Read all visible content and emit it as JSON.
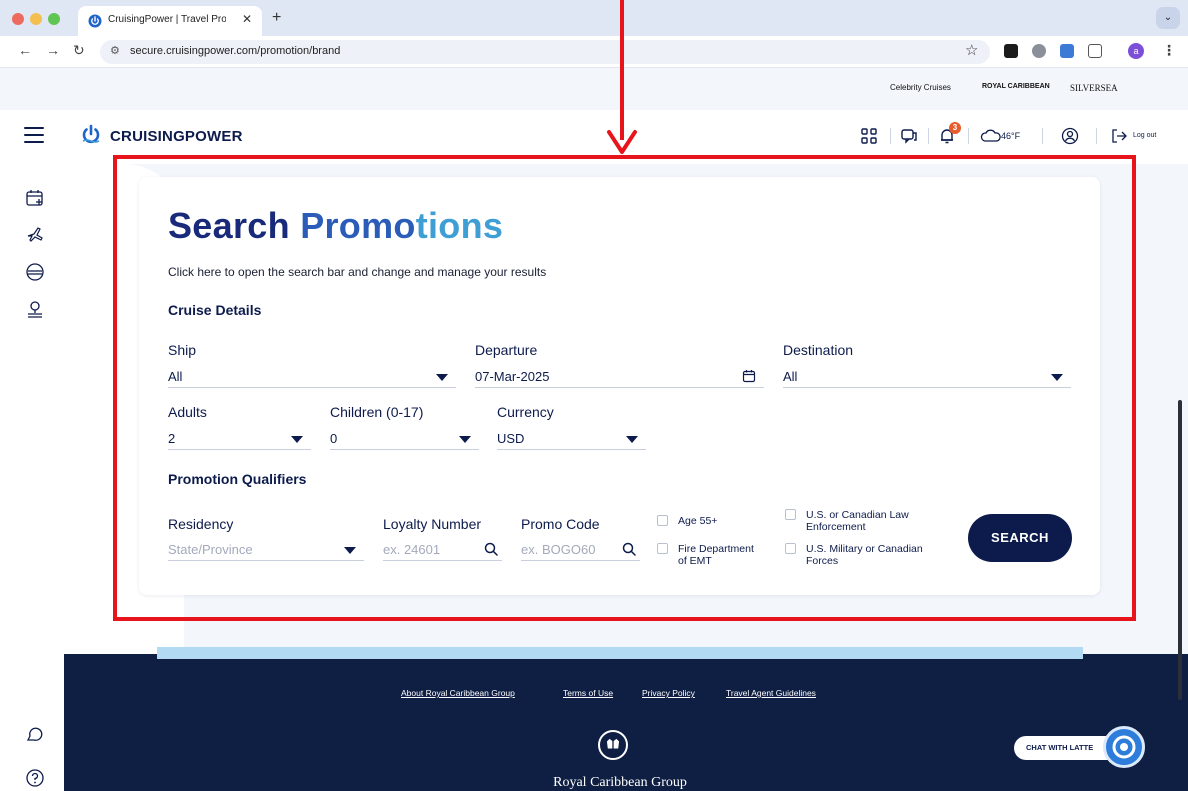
{
  "browser": {
    "tab_title": "CruisingPower | Travel Profes",
    "url": "secure.cruisingpower.com/promotion/brand",
    "profile_initial": "a"
  },
  "brands": [
    "Celebrity Cruises",
    "ROYAL CARIBBEAN",
    "SILVERSEA"
  ],
  "header": {
    "logo_text": "CRUISINGPOWER",
    "notification_count": "3",
    "weather": "46°F",
    "logout_label": "Log out"
  },
  "search": {
    "title_part1": "Search ",
    "title_part2": "Promo",
    "title_part3": "tions",
    "subtitle": "Click here to open the search bar and change and manage your results",
    "cruise_details_heading": "Cruise Details",
    "ship_label": "Ship",
    "ship_value": "All",
    "departure_label": "Departure",
    "departure_value": "07-Mar-2025",
    "destination_label": "Destination",
    "destination_value": "All",
    "adults_label": "Adults",
    "adults_value": "2",
    "children_label": "Children (0-17)",
    "children_value": "0",
    "currency_label": "Currency",
    "currency_value": "USD",
    "qualifiers_heading": "Promotion Qualifiers",
    "residency_label": "Residency",
    "residency_placeholder": "State/Province",
    "loyalty_label": "Loyalty Number",
    "loyalty_placeholder": "ex. 24601",
    "promo_label": "Promo Code",
    "promo_placeholder": "ex. BOGO60",
    "checkbox_age": "Age 55+",
    "checkbox_fire_line1": "Fire Department",
    "checkbox_fire_line2": "of EMT",
    "checkbox_law_line1": "U.S. or Canadian Law",
    "checkbox_law_line2": "Enforcement",
    "checkbox_military_line1": "U.S. Military or Canadian",
    "checkbox_military_line2": "Forces",
    "search_button": "SEARCH"
  },
  "footer": {
    "links": [
      "About Royal Caribbean Group",
      "Terms of Use",
      "Privacy Policy",
      "Travel Agent Guidelines"
    ],
    "company": "Royal Caribbean Group",
    "chat_label": "CHAT WITH LATTE"
  },
  "colors": {
    "navy": "#0d1b4c",
    "highlight_red": "#e8141c",
    "footer_bg": "#0f1f43"
  }
}
